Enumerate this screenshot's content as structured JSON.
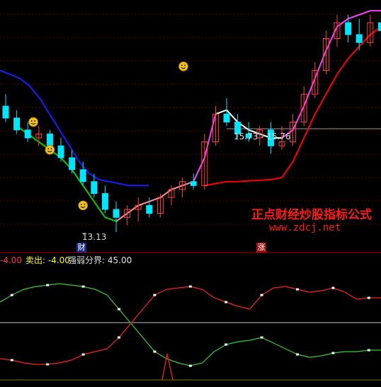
{
  "chart_data": [
    {
      "type": "candlestick",
      "colors": {
        "up": "#ff4040",
        "down": "#00e5ff",
        "ma_fast": "#ff40ff",
        "ma_slow": "#ff0000",
        "ma_long": "#1a1aff"
      },
      "candles": [
        {
          "o": 16.3,
          "h": 16.6,
          "l": 15.9,
          "c": 16.0
        },
        {
          "o": 16.0,
          "h": 16.2,
          "l": 15.6,
          "c": 15.7
        },
        {
          "o": 15.7,
          "h": 15.9,
          "l": 15.4,
          "c": 15.5
        },
        {
          "o": 15.5,
          "h": 15.8,
          "l": 15.3,
          "c": 15.6
        },
        {
          "o": 15.6,
          "h": 15.7,
          "l": 15.2,
          "c": 15.3
        },
        {
          "o": 15.3,
          "h": 15.5,
          "l": 14.9,
          "c": 15.0
        },
        {
          "o": 15.0,
          "h": 15.2,
          "l": 14.6,
          "c": 14.7
        },
        {
          "o": 14.7,
          "h": 14.9,
          "l": 14.3,
          "c": 14.4
        },
        {
          "o": 14.4,
          "h": 14.6,
          "l": 14.0,
          "c": 14.1
        },
        {
          "o": 14.1,
          "h": 14.3,
          "l": 13.6,
          "c": 13.7
        },
        {
          "o": 13.7,
          "h": 13.9,
          "l": 13.13,
          "c": 13.5
        },
        {
          "o": 13.5,
          "h": 13.8,
          "l": 13.3,
          "c": 13.7
        },
        {
          "o": 13.7,
          "h": 14.0,
          "l": 13.4,
          "c": 13.8
        },
        {
          "o": 13.8,
          "h": 14.0,
          "l": 13.5,
          "c": 13.6
        },
        {
          "o": 13.6,
          "h": 14.1,
          "l": 13.5,
          "c": 14.0
        },
        {
          "o": 14.0,
          "h": 14.3,
          "l": 13.8,
          "c": 14.2
        },
        {
          "o": 14.2,
          "h": 14.5,
          "l": 14.0,
          "c": 14.4
        },
        {
          "o": 14.4,
          "h": 14.6,
          "l": 14.2,
          "c": 14.3
        },
        {
          "o": 14.3,
          "h": 15.6,
          "l": 14.2,
          "c": 15.4
        },
        {
          "o": 15.4,
          "h": 16.3,
          "l": 15.3,
          "c": 16.1
        },
        {
          "o": 16.1,
          "h": 16.5,
          "l": 15.8,
          "c": 15.9
        },
        {
          "o": 15.9,
          "h": 16.1,
          "l": 15.5,
          "c": 15.6
        },
        {
          "o": 15.6,
          "h": 15.9,
          "l": 15.4,
          "c": 15.5
        },
        {
          "o": 15.5,
          "h": 15.8,
          "l": 15.3,
          "c": 15.7
        },
        {
          "o": 15.7,
          "h": 15.9,
          "l": 15.1,
          "c": 15.3
        },
        {
          "o": 15.3,
          "h": 15.8,
          "l": 15.2,
          "c": 15.4
        },
        {
          "o": 15.4,
          "h": 16.1,
          "l": 15.3,
          "c": 15.9
        },
        {
          "o": 15.9,
          "h": 16.8,
          "l": 15.8,
          "c": 16.6
        },
        {
          "o": 16.6,
          "h": 17.4,
          "l": 16.5,
          "c": 17.2
        },
        {
          "o": 17.2,
          "h": 18.2,
          "l": 17.1,
          "c": 18.0
        },
        {
          "o": 18.0,
          "h": 18.6,
          "l": 17.8,
          "c": 18.4
        },
        {
          "o": 18.4,
          "h": 18.6,
          "l": 17.9,
          "c": 18.1
        },
        {
          "o": 18.1,
          "h": 18.5,
          "l": 17.7,
          "c": 17.9
        },
        {
          "o": 17.9,
          "h": 18.6,
          "l": 17.8,
          "c": 18.4
        },
        {
          "o": 18.4,
          "h": 18.6,
          "l": 17.9,
          "c": 18.2
        },
        {
          "o": 18.2,
          "h": 18.6,
          "l": 18.1,
          "c": 18.5
        }
      ],
      "ma_fast": [
        null,
        15.8,
        15.6,
        15.4,
        15.2,
        15.0,
        14.7,
        14.3,
        13.9,
        13.5,
        13.4,
        13.6,
        13.8,
        13.9,
        14.0,
        14.2,
        14.3,
        14.4,
        15.0,
        16.1,
        16.2,
        15.9,
        15.7,
        15.6,
        15.5,
        15.5,
        15.7,
        16.3,
        17.0,
        17.7,
        18.3,
        18.5,
        18.6,
        18.7,
        18.7,
        18.7
      ],
      "ma_slow": [
        null,
        null,
        null,
        null,
        null,
        null,
        null,
        null,
        null,
        null,
        null,
        null,
        null,
        null,
        null,
        null,
        null,
        null,
        14.3,
        14.35,
        14.4,
        14.4,
        14.42,
        14.43,
        14.45,
        14.5,
        14.9,
        15.5,
        16.1,
        16.6,
        17.1,
        17.5,
        17.8,
        18.1,
        18.3,
        18.5
      ],
      "ma_long": [
        17.2,
        17.1,
        17.0,
        16.8,
        16.5,
        16.1,
        15.7,
        15.3,
        14.9,
        14.6,
        14.45,
        14.4,
        14.35,
        14.3,
        14.3,
        14.3
      ],
      "annotations": {
        "low_label": "13.13",
        "level_label": "15.73 - 15.76"
      },
      "badges": {
        "buy": "财",
        "sell": "涨"
      }
    },
    {
      "type": "line",
      "series": [
        {
          "name": "",
          "values": [
            55,
            60,
            64,
            66,
            67,
            68,
            67,
            66,
            64,
            60,
            50,
            40,
            30,
            20,
            15,
            12,
            10,
            12,
            20,
            25,
            27,
            28,
            30,
            26,
            22,
            18,
            16,
            17,
            19,
            20,
            20,
            21,
            21
          ]
        },
        {
          "name": "",
          "values": [
            15,
            14,
            12,
            11,
            11,
            12,
            14,
            18,
            20,
            22,
            30,
            40,
            50,
            60,
            64,
            65,
            66,
            64,
            58,
            55,
            52,
            50,
            60,
            65,
            66,
            64,
            62,
            63,
            65,
            62,
            57,
            58,
            58
          ]
        }
      ],
      "threshold": 45.0,
      "ylim": [
        0,
        80
      ]
    }
  ],
  "legend": {
    "prefix": "-4.00",
    "sell_text": "卖出: -4.00",
    "boundary_text": "强弱分界: 45.00"
  },
  "watermark": {
    "line1": "正点财经炒股指标公式",
    "line2": "www.zdcj.net"
  },
  "icons": [
    "smiley-icon",
    "smiley-icon",
    "smiley-icon",
    "smiley-icon"
  ]
}
